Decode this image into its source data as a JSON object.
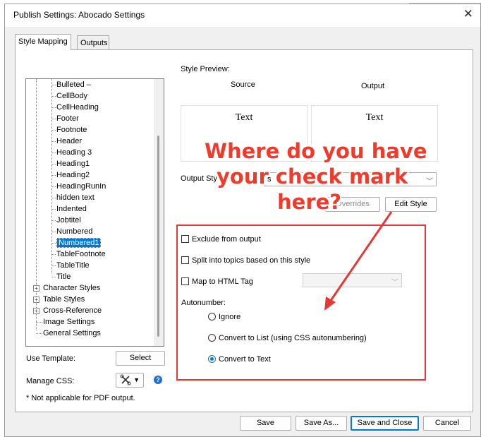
{
  "window": {
    "title": "Publish Settings: Abocado Settings",
    "close_glyph": "✕"
  },
  "tabs": [
    {
      "label": "Style Mapping"
    },
    {
      "label": "Outputs"
    }
  ],
  "tree": {
    "items": [
      "Bulleted –",
      "CellBody",
      "CellHeading",
      "Footer",
      "Footnote",
      "Header",
      "Heading 3",
      "Heading1",
      "Heading2",
      "HeadingRunIn",
      "hidden text",
      "Indented",
      "Jobtitel",
      "Numbered",
      "Numbered1",
      "TableFootnote",
      "TableTitle",
      "Title"
    ],
    "selected": "Numbered1",
    "groups": [
      "Character Styles",
      "Table Styles",
      "Cross-Reference"
    ],
    "leaves": [
      "Image Settings",
      "General Settings"
    ],
    "expander_glyph": "+"
  },
  "template": {
    "label": "Use Template:",
    "select_button": "Select"
  },
  "css": {
    "label": "Manage CSS:",
    "help_glyph": "?"
  },
  "note": "* Not applicable for PDF output.",
  "preview": {
    "header": "Style Preview:",
    "source_label": "Source",
    "output_label": "Output",
    "source_text": "Text",
    "output_text": "Text"
  },
  "output_style": {
    "label": "Output Sty",
    "value": "s"
  },
  "buttons": {
    "overrides": "Overrides",
    "edit_style": "Edit Style"
  },
  "options": {
    "exclude": {
      "label": "Exclude from output",
      "checked": false
    },
    "split": {
      "label": "Split into topics based on this style",
      "checked": false
    },
    "map_html": {
      "label": "Map to HTML Tag",
      "checked": false,
      "value": ""
    }
  },
  "autonumber": {
    "label": "Autonumber:",
    "options": [
      {
        "label": "Ignore",
        "checked": false
      },
      {
        "label": "Convert to List (using CSS autonumbering)",
        "checked": false
      },
      {
        "label": "Convert to Text",
        "checked": true
      }
    ]
  },
  "footer_buttons": {
    "save": "Save",
    "save_as": "Save As...",
    "save_close": "Save and Close",
    "cancel": "Cancel"
  },
  "annotation": {
    "lines": [
      "Where do you have",
      "your check mark",
      "here?"
    ],
    "color": "#ef3b2c"
  }
}
